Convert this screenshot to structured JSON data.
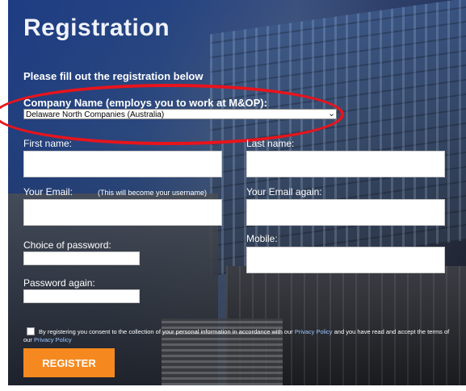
{
  "form": {
    "title": "Registration",
    "subtitle": "Please fill out the registration below",
    "company": {
      "label": "Company Name (employs you to work at M&OP):",
      "selected": "Delaware North Companies (Australia)"
    },
    "first_name_label": "First name:",
    "last_name_label": "Last name:",
    "email_label": "Your Email:",
    "email_hint": "(This will become your username)",
    "email_again_label": "Your Email again:",
    "password_label": "Choice of password:",
    "mobile_label": "Mobile:",
    "password_again_label": "Password again:",
    "consent": {
      "text_before": "By registering you consent to the collection of your personal information in accordance with our ",
      "link1": "Privacy Policy",
      "text_middle": " and you have read and accept the terms of our ",
      "link2": "Privacy Policy"
    },
    "register_label": "REGISTER"
  },
  "colors": {
    "accent_button": "#f5891f",
    "highlight_ellipse": "#e8141c",
    "link": "#9cc7ff"
  }
}
